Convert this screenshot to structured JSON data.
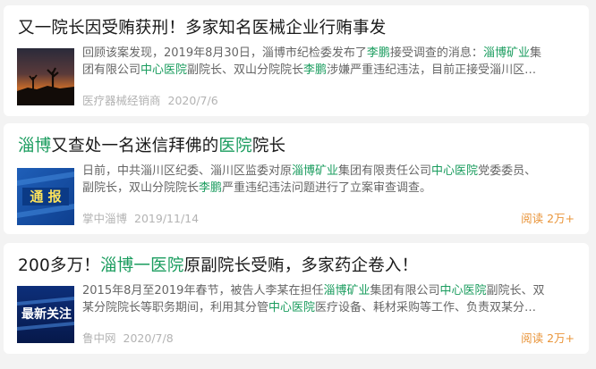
{
  "articles": [
    {
      "title": [
        {
          "text": "又一院长因受贿获刑！多家知名医械企业行贿事发",
          "hl": false
        }
      ],
      "desc_lines": [
        [
          {
            "text": "回顾该案发现，2019年8月30日，淄博市纪检委发布了",
            "hl": false
          },
          {
            "text": "李鹏",
            "hl": true
          },
          {
            "text": "接受调查的消息：",
            "hl": false
          },
          {
            "text": "淄博矿业",
            "hl": true
          },
          {
            "text": "集",
            "hl": false
          }
        ],
        [
          {
            "text": "团有限公司",
            "hl": false
          },
          {
            "text": "中心医院",
            "hl": true
          },
          {
            "text": "副院长、双山分院院长",
            "hl": false
          },
          {
            "text": "李鹏",
            "hl": true
          },
          {
            "text": "涉嫌严重违纪违法，目前正接受淄川区…",
            "hl": false
          }
        ]
      ],
      "source": "医疗器械经销商",
      "date": "2020/7/6",
      "reads": "",
      "thumb_icon": "sunset-silhouette-image"
    },
    {
      "title": [
        {
          "text": "淄博",
          "hl": true
        },
        {
          "text": "又查处一名迷信拜佛的",
          "hl": false
        },
        {
          "text": "医院",
          "hl": true
        },
        {
          "text": "院长",
          "hl": false
        }
      ],
      "desc_lines": [
        [
          {
            "text": "日前，中共淄川区纪委、淄川区监委对原",
            "hl": false
          },
          {
            "text": "淄博矿业",
            "hl": true
          },
          {
            "text": "集团有限责任公司",
            "hl": false
          },
          {
            "text": "中心医院",
            "hl": true
          },
          {
            "text": "党委委员、",
            "hl": false
          }
        ],
        [
          {
            "text": "副院长，双山分院院长",
            "hl": false
          },
          {
            "text": "李鹏",
            "hl": true
          },
          {
            "text": "严重违纪违法问题进行了立案审查调查。",
            "hl": false
          }
        ]
      ],
      "source": "掌中淄博",
      "date": "2019/11/14",
      "reads": "阅读 2万+",
      "thumb_icon": "news-report-image",
      "thumb_text": "通 报"
    },
    {
      "title": [
        {
          "text": "200多万！",
          "hl": false
        },
        {
          "text": "淄博一医院",
          "hl": true
        },
        {
          "text": "原副院长受贿，多家药企卷入！",
          "hl": false
        }
      ],
      "desc_lines": [
        [
          {
            "text": "2015年8月至2019年春节，被告人李某在担任",
            "hl": false
          },
          {
            "text": "淄博矿业",
            "hl": true
          },
          {
            "text": "集团有限公司",
            "hl": false
          },
          {
            "text": "中心医院",
            "hl": true
          },
          {
            "text": "副院长、双",
            "hl": false
          }
        ],
        [
          {
            "text": "某分院院长等职务期间，利用其分管",
            "hl": false
          },
          {
            "text": "中心医院",
            "hl": true
          },
          {
            "text": "医疗设备、耗材采购等工作、负责双某分…",
            "hl": false
          }
        ]
      ],
      "source": "鲁中网",
      "date": "2020/7/8",
      "reads": "阅读 2万+",
      "thumb_icon": "latest-news-banner-image",
      "thumb_text": "最新关注"
    }
  ],
  "colors": {
    "highlight": "#1a9c5e",
    "reads": "#e9953a",
    "meta": "#b3b3b3",
    "background": "#f3f3f3"
  }
}
